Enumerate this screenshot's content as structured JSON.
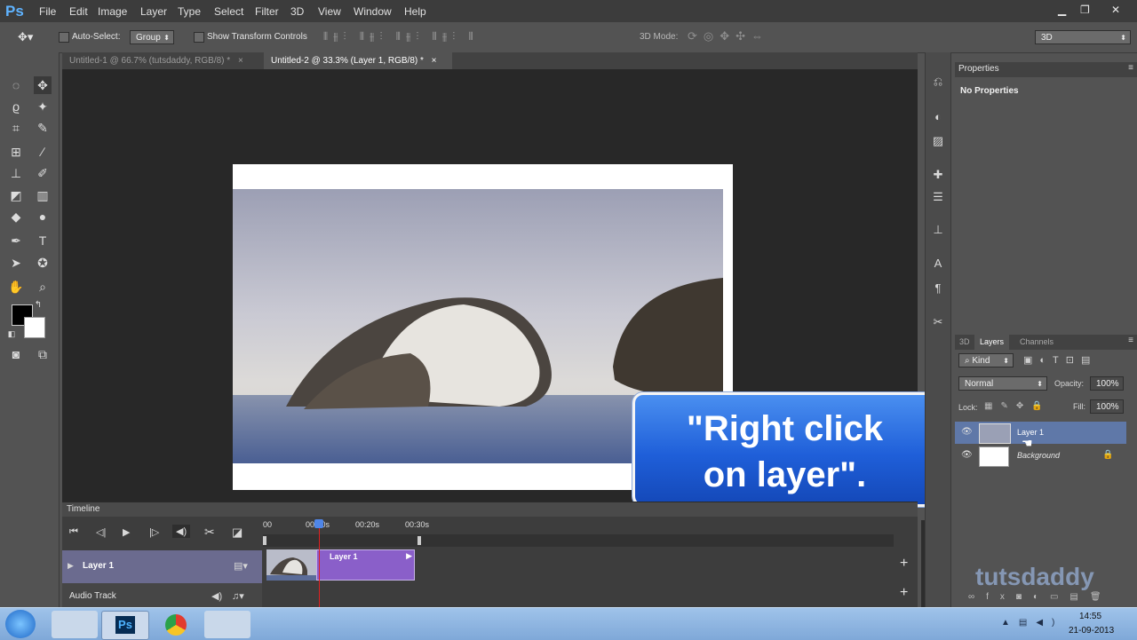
{
  "app": {
    "logo": "Ps",
    "menu": [
      "File",
      "Edit",
      "Image",
      "Layer",
      "Type",
      "Select",
      "Filter",
      "3D",
      "View",
      "Window",
      "Help"
    ]
  },
  "options_bar": {
    "auto_select_label": "Auto-Select:",
    "auto_select_value": "Group",
    "show_transform_label": "Show Transform Controls",
    "mode_3d_label": "3D Mode:",
    "workspace_value": "3D"
  },
  "tabs": [
    {
      "label": "Untitled-1 @ 66.7% (tutsdaddy, RGB/8) *",
      "close": "×"
    },
    {
      "label": "Untitled-2 @ 33.3% (Layer 1, RGB/8) *",
      "close": "×"
    }
  ],
  "callout": {
    "line1": "\"Right click",
    "line2": "on layer\"."
  },
  "timeline": {
    "title": "Timeline",
    "ruler_labels": [
      "00",
      "00:10s",
      "00:20s",
      "00:30s"
    ],
    "track_layer": "Layer 1",
    "track_audio": "Audio Track",
    "clip_label": "Layer 1"
  },
  "properties": {
    "title": "Properties",
    "content": "No Properties"
  },
  "layers_panel": {
    "tabs": [
      "3D",
      "Layers",
      "Channels"
    ],
    "filter_label": "Kind",
    "blend_mode": "Normal",
    "opacity_label": "Opacity:",
    "opacity_value": "100%",
    "lock_label": "Lock:",
    "fill_label": "Fill:",
    "fill_value": "100%",
    "layers": [
      {
        "name": "Layer 1",
        "selected": true
      },
      {
        "name": "Background",
        "selected": false,
        "locked": true
      }
    ],
    "watermark": "tutsdaddy"
  },
  "taskbar": {
    "time": "14:55",
    "date": "21-09-2013"
  },
  "colors": {
    "callout_blue": "#1f5fd9",
    "clip_purple": "#8a5fc9",
    "playhead_red": "#e02020",
    "ps_blue": "#5fb3ff"
  }
}
